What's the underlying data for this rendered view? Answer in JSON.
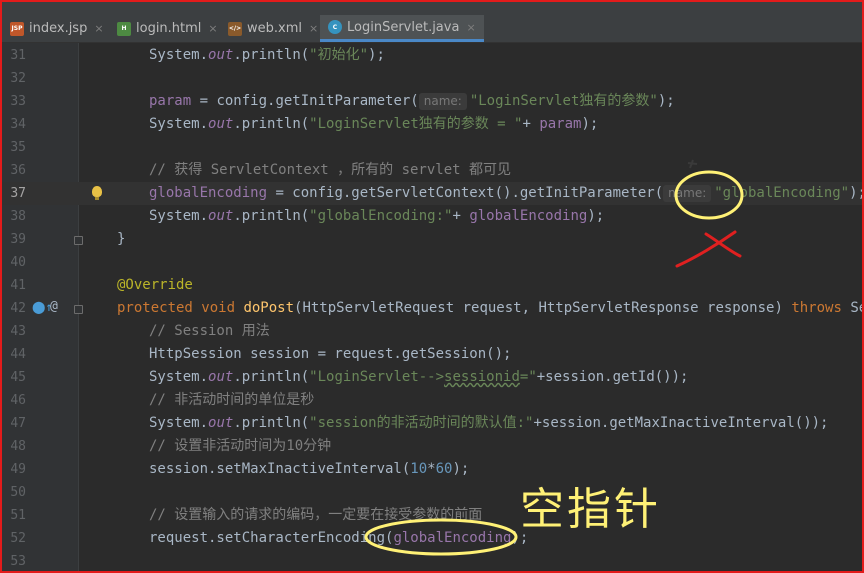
{
  "tabs": [
    {
      "label": "index.jsp",
      "icon": "jsp-file-icon",
      "badge": "JSP"
    },
    {
      "label": "login.html",
      "icon": "html-file-icon",
      "badge": "H"
    },
    {
      "label": "web.xml",
      "icon": "xml-file-icon",
      "badge": "</>"
    },
    {
      "label": "LoginServlet.java",
      "icon": "java-class-icon",
      "badge": "C",
      "active": true
    }
  ],
  "close_glyph": "×",
  "lines": {
    "31": {
      "no": "31"
    },
    "32": {
      "no": "32"
    },
    "33": {
      "no": "33"
    },
    "34": {
      "no": "34"
    },
    "35": {
      "no": "35"
    },
    "36": {
      "no": "36"
    },
    "37": {
      "no": "37"
    },
    "38": {
      "no": "38"
    },
    "39": {
      "no": "39"
    },
    "40": {
      "no": "40"
    },
    "41": {
      "no": "41"
    },
    "42": {
      "no": "42"
    },
    "43": {
      "no": "43"
    },
    "44": {
      "no": "44"
    },
    "45": {
      "no": "45"
    },
    "46": {
      "no": "46"
    },
    "47": {
      "no": "47"
    },
    "48": {
      "no": "48"
    },
    "49": {
      "no": "49"
    },
    "50": {
      "no": "50"
    },
    "51": {
      "no": "51"
    },
    "52": {
      "no": "52"
    },
    "53": {
      "no": "53"
    }
  },
  "code": {
    "l31_str": "\"初始化\"",
    "l33_var": "param",
    "l33_mid": " = config.getInitParameter(",
    "l33_hint": "name:",
    "l33_str": "\"LoginServlet独有的参数\"",
    "l34_str": "\"LoginServlet独有的参数 = \"",
    "l34_var": "param",
    "l36_cmt": "// 获得 ServletContext ，所有的 servlet 都可见",
    "l37_var": "globalEncoding",
    "l37_mid": " = config.getServletContext().getInitParameter(",
    "l37_hint": "name:",
    "l37_str": "\"globalEncoding\"",
    "l38_str": "\"globalEncoding:\"",
    "l38_var": "globalEncoding",
    "l41_ann": "@Override",
    "l42_kw1": "protected void ",
    "l42_fn": "doPost",
    "l42_mid": "(HttpServletRequest request, HttpServletResponse response) ",
    "l42_kw2": "throws ",
    "l42_end": "ServletException",
    "l43_cmt": "// Session 用法",
    "l44": "HttpSession session = request.getSession();",
    "l45_str1": "\"LoginServlet-->",
    "l45_wavy": "sessionid",
    "l45_str2": "=\"",
    "l45_end": "+session.getId());",
    "l46_cmt": "// 非活动时间的单位是秒",
    "l47_str": "\"session的非活动时间的默认值:\"",
    "l47_end": "+session.getMaxInactiveInterval());",
    "l48_cmt": "// 设置非活动时间为10分钟",
    "l49_pre": "session.setMaxInactiveInterval(",
    "l49_n1": "10",
    "l49_op": "*",
    "l49_n2": "60",
    "l49_end": ");",
    "l51_cmt": "// 设置输入的请求的编码，一定要在接受参数的前面",
    "l52_pre": "request.setCharacterEncoding(",
    "l52_var": "globalEncoding",
    "l52_end": ");",
    "system": "System.",
    "out": "out",
    "println": ".println(",
    "close": ");",
    "plus": "+ ",
    "brace": "}"
  },
  "annotation": {
    "text": "空指针",
    "color": "#fff176",
    "mark_color": "#e02020"
  },
  "colors": {
    "keyword": "#cc7832",
    "string": "#6a8759",
    "field": "#9876aa",
    "comment": "#808080",
    "annotation": "#bbb529",
    "number": "#6897bb",
    "method": "#ffc66d",
    "text": "#a9b7c6",
    "background": "#2b2b2b"
  }
}
